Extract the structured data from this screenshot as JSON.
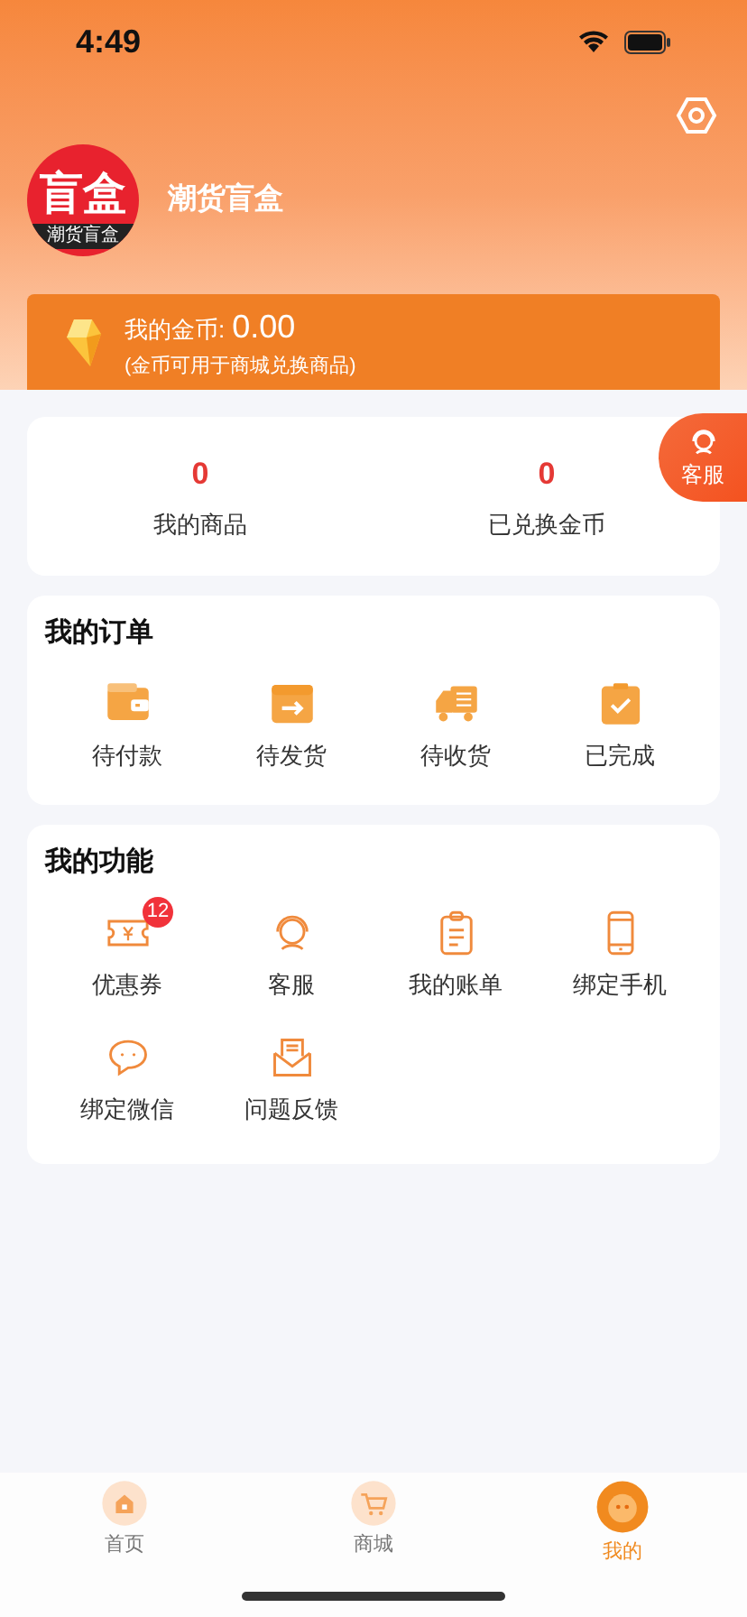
{
  "status_bar": {
    "time": "4:49"
  },
  "profile": {
    "avatar": {
      "title": "盲盒",
      "subtitle": "潮货盲盒"
    },
    "name": "潮货盲盒"
  },
  "coins": {
    "label": "我的金币:",
    "amount": "0.00",
    "note": "(金币可用于商城兑换商品)"
  },
  "stats": [
    {
      "value": "0",
      "label": "我的商品"
    },
    {
      "value": "0",
      "label": "已兑换金币"
    }
  ],
  "floating_service": {
    "label": "客服"
  },
  "orders": {
    "title": "我的订单",
    "items": [
      {
        "kind": "wallet",
        "label": "待付款"
      },
      {
        "kind": "box",
        "label": "待发货"
      },
      {
        "kind": "truck",
        "label": "待收货"
      },
      {
        "kind": "clipboard",
        "label": "已完成"
      }
    ]
  },
  "functions": {
    "title": "我的功能",
    "items": [
      {
        "kind": "ticket",
        "label": "优惠券",
        "badge": "12"
      },
      {
        "kind": "headset",
        "label": "客服"
      },
      {
        "kind": "bill",
        "label": "我的账单"
      },
      {
        "kind": "phone",
        "label": "绑定手机"
      },
      {
        "kind": "chat",
        "label": "绑定微信"
      },
      {
        "kind": "mail",
        "label": "问题反馈"
      }
    ]
  },
  "tab_bar": [
    {
      "kind": "home",
      "label": "首页",
      "selected": false
    },
    {
      "kind": "cart",
      "label": "商城",
      "selected": false
    },
    {
      "kind": "face",
      "label": "我的",
      "selected": true
    }
  ]
}
